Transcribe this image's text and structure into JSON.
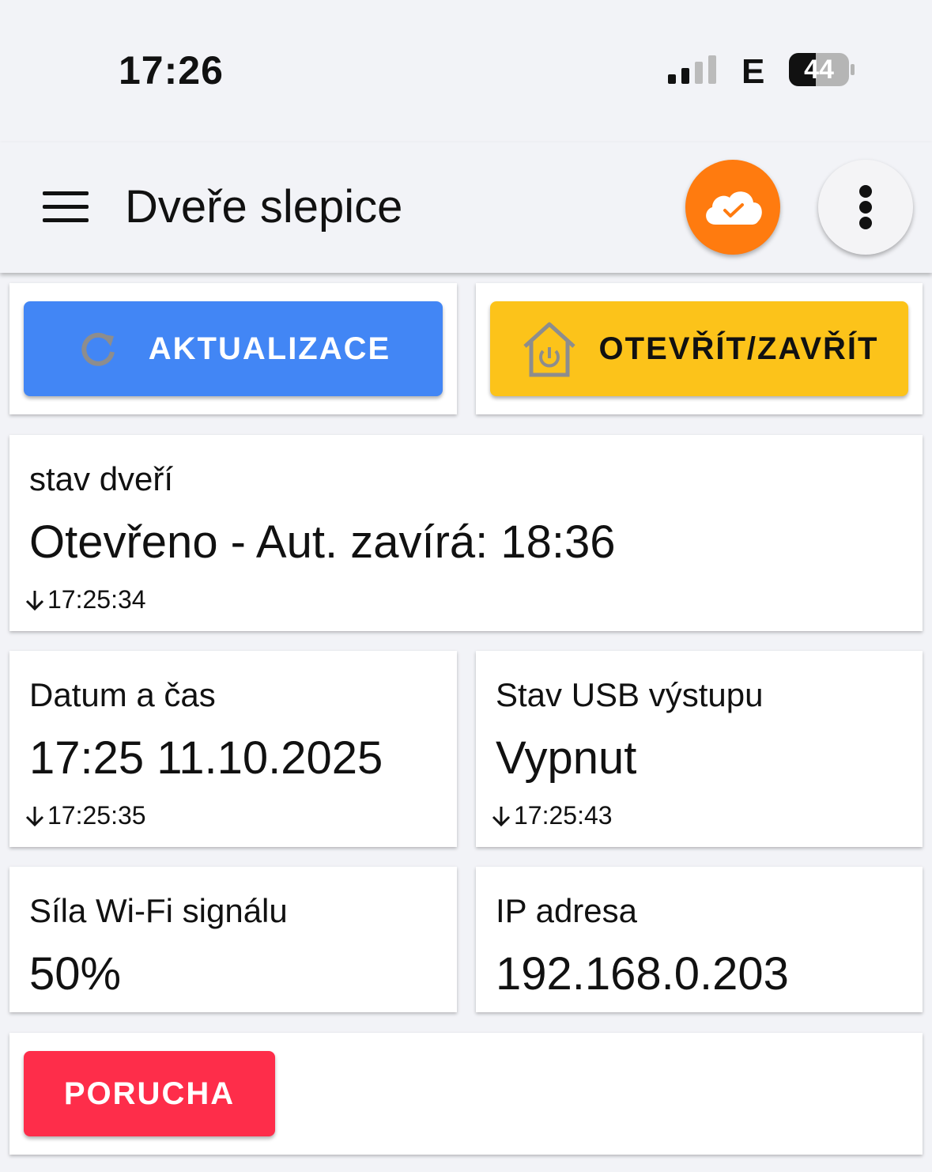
{
  "status_bar": {
    "time": "17:26",
    "network": "E",
    "battery": "44"
  },
  "app_bar": {
    "title": "Dveře slepice"
  },
  "buttons": {
    "refresh_label": "AKTUALIZACE",
    "toggle_label": "OTEVŘÍT/ZAVŘÍT",
    "fault_label": "PORUCHA"
  },
  "door_status": {
    "label": "stav dveří",
    "value": "Otevřeno - Aut. zavírá: 18:36",
    "updated": "17:25:34"
  },
  "date_time": {
    "label": "Datum a čas",
    "value": "17:25 11.10.2025",
    "updated": "17:25:35"
  },
  "usb_status": {
    "label": "Stav USB výstupu",
    "value": "Vypnut",
    "updated": "17:25:43"
  },
  "wifi_signal": {
    "label": "Síla Wi-Fi signálu",
    "value": "50%"
  },
  "ip_address": {
    "label": "IP adresa",
    "value": "192.168.0.203"
  },
  "colors": {
    "refresh_button": "#4286f5",
    "toggle_button": "#fcc31a",
    "fault_button": "#fe2d4a",
    "cloud_button": "#ff7b0f"
  },
  "icons": {
    "menu": "hamburger-menu-icon",
    "cloud": "cloud-check-icon",
    "more": "more-vertical-icon",
    "refresh": "refresh-icon",
    "toggle": "house-power-icon",
    "updated": "arrow-down-icon"
  }
}
